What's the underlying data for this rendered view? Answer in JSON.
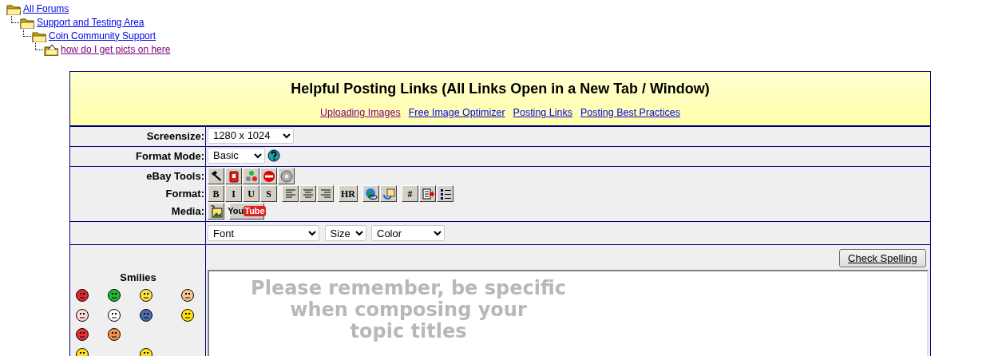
{
  "breadcrumbs": [
    {
      "label": "All Forums",
      "visited": false,
      "children": [
        {
          "label": "Support and Testing Area",
          "visited": false,
          "children": [
            {
              "label": "Coin Community Support",
              "visited": false,
              "children": [
                {
                  "label": "how do I get picts on here",
                  "visited": true,
                  "kind": "topic"
                }
              ]
            }
          ]
        }
      ]
    }
  ],
  "header": {
    "title": "Helpful Posting Links (All Links Open in a New Tab / Window)",
    "links": [
      {
        "label": "Uploading Images",
        "visited": true
      },
      {
        "label": "Free Image Optimizer",
        "visited": false
      },
      {
        "label": "Posting Links",
        "visited": false
      },
      {
        "label": "Posting Best Practices",
        "visited": false
      }
    ]
  },
  "screensize": {
    "label": "Screensize:",
    "value": "1280 x 1024"
  },
  "format_mode": {
    "label": "Format Mode:",
    "value": "Basic"
  },
  "toolbars": [
    {
      "label": "eBay Tools:",
      "buttons": [
        {
          "kind": "gavel"
        },
        {
          "kind": "phone"
        },
        {
          "kind": "balls"
        },
        {
          "kind": "stop"
        },
        {
          "kind": "disc"
        }
      ]
    },
    {
      "label": "Format:",
      "buttons": [
        {
          "kind": "glyph",
          "glyph": "B"
        },
        {
          "kind": "glyph",
          "glyph": "I"
        },
        {
          "kind": "glyph",
          "glyph": "U"
        },
        {
          "kind": "glyph",
          "glyph": "S"
        },
        {
          "kind": "align-left"
        },
        {
          "kind": "align-center"
        },
        {
          "kind": "align-right"
        },
        {
          "kind": "glyph",
          "glyph": "HR"
        },
        {
          "kind": "globe"
        },
        {
          "kind": "swap"
        },
        {
          "kind": "glyph",
          "glyph": "#"
        },
        {
          "kind": "doc"
        },
        {
          "kind": "list"
        }
      ]
    },
    {
      "label": "Media:",
      "buttons": [
        {
          "kind": "image"
        },
        {
          "kind": "video",
          "glyph": "You",
          "glyph2": "Tube"
        }
      ]
    }
  ],
  "font_selects": [
    {
      "value": "Font"
    },
    {
      "value": "Size"
    },
    {
      "value": "Color"
    }
  ],
  "check_spelling": "Check Spelling",
  "smilies": {
    "title": "Smilies",
    "rows": [
      [
        {
          "color": "#e02828"
        },
        {
          "color": "#20b830"
        },
        {
          "color": "#ffe040"
        },
        {
          "color": "#f8c490"
        }
      ],
      [
        {
          "color": "#ffd8d8"
        },
        {
          "color": "#ffffff"
        },
        {
          "color": "#4a6cb0"
        },
        {
          "color": "#ffe000"
        }
      ],
      [
        {
          "color": "#e83030"
        },
        {
          "color": "#f09050"
        }
      ],
      [
        {
          "color": "#ffe020"
        },
        {
          "color": "#ffe020"
        }
      ]
    ]
  },
  "message_hint": "Please remember, be specific\nwhen composing your\ntopic titles"
}
